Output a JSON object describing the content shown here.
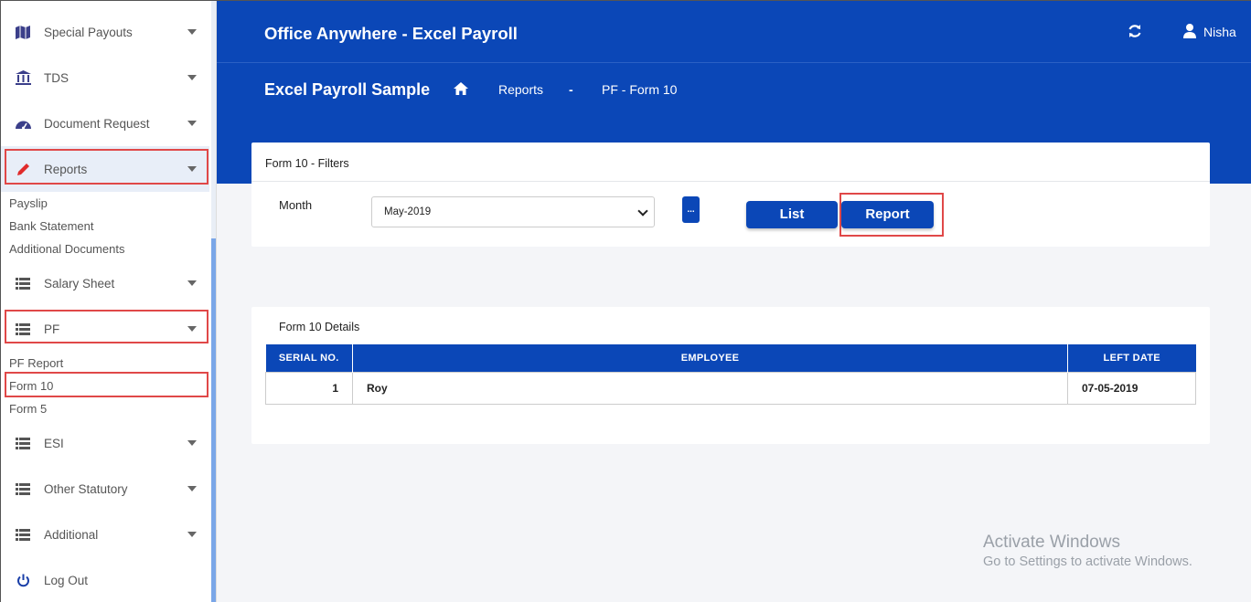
{
  "sidebar": {
    "items": [
      {
        "label": "Special Payouts",
        "icon": "map-icon"
      },
      {
        "label": "TDS",
        "icon": "bank-icon"
      },
      {
        "label": "Document Request",
        "icon": "dashboard-icon"
      },
      {
        "label": "Reports",
        "icon": "pencil-icon"
      },
      {
        "label": "Salary Sheet",
        "icon": "list-icon"
      },
      {
        "label": "PF",
        "icon": "list-icon"
      },
      {
        "label": "ESI",
        "icon": "list-icon"
      },
      {
        "label": "Other Statutory",
        "icon": "list-icon"
      },
      {
        "label": "Additional",
        "icon": "list-icon"
      },
      {
        "label": "Log Out",
        "icon": "power-icon"
      }
    ],
    "reports_sub": [
      "Payslip",
      "Bank Statement",
      "Additional Documents"
    ],
    "pf_sub": [
      "PF Report",
      "Form 10",
      "Form 5"
    ]
  },
  "header": {
    "app_title": "Office Anywhere - Excel Payroll",
    "user_name": "Nisha",
    "breadcrumb": {
      "company": "Excel Payroll Sample",
      "section": "Reports",
      "separator": "-",
      "page": "PF - Form 10"
    }
  },
  "filters": {
    "title": "Form 10 - Filters",
    "month_label": "Month",
    "month_value": "May-2019",
    "dots_label": "...",
    "list_button": "List",
    "report_button": "Report"
  },
  "details": {
    "title": "Form 10 Details",
    "columns": [
      "SERIAL NO.",
      "EMPLOYEE",
      "LEFT DATE"
    ],
    "rows": [
      {
        "serial": "1",
        "employee": "Roy",
        "left_date": "07-05-2019"
      }
    ]
  },
  "watermark": {
    "line1": "Activate Windows",
    "line2": "Go to Settings to activate Windows."
  },
  "colors": {
    "primary": "#0b47b7",
    "highlight": "#e04848"
  }
}
